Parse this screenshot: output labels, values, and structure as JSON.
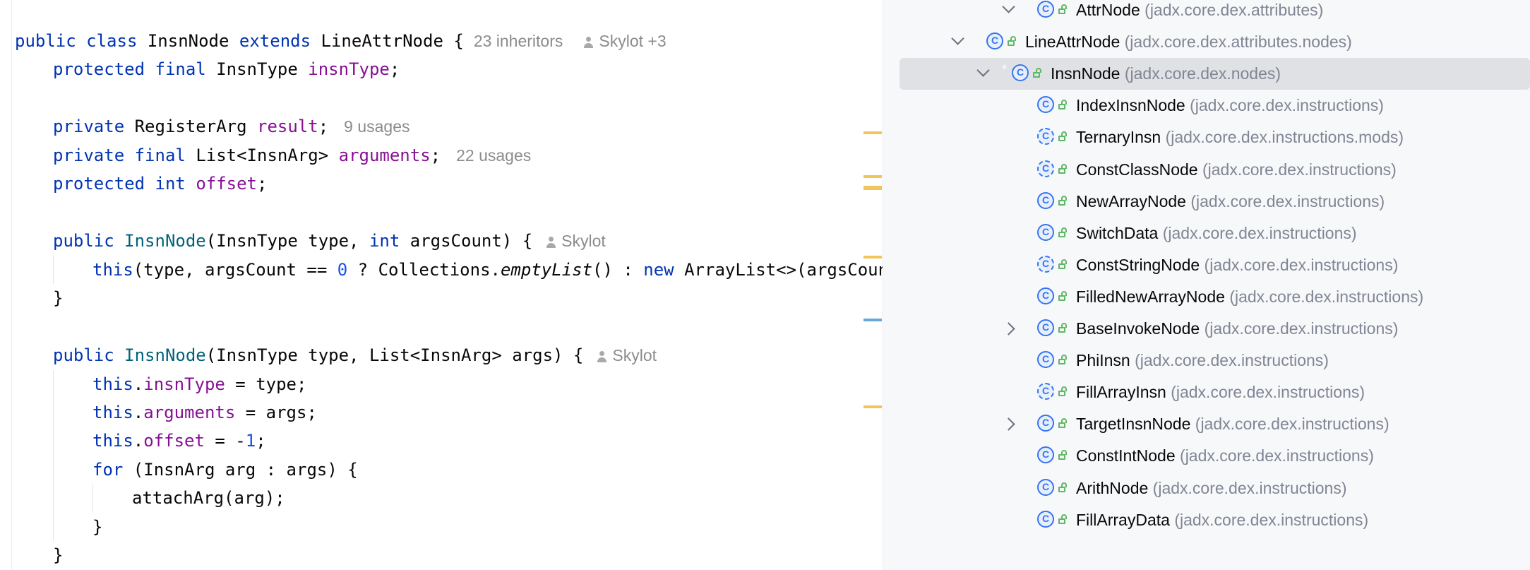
{
  "editor": {
    "class_decl": {
      "kw_public": "public",
      "kw_class": "class",
      "class_name": "InsnNode",
      "kw_extends": "extends",
      "parent_name": "LineAttrNode",
      "brace": "{",
      "inheritors_hint": "23 inheritors",
      "author_hint": "Skylot +3"
    },
    "field_insnType": {
      "kw1": "protected",
      "kw2": "final",
      "type": "InsnType",
      "name": "insnType",
      "end": ";"
    },
    "field_result": {
      "kw1": "private",
      "type": "RegisterArg",
      "name": "result",
      "end": ";",
      "usages": "9 usages"
    },
    "field_arguments": {
      "kw1": "private",
      "kw2": "final",
      "type": "List<InsnArg>",
      "name": "arguments",
      "end": ";",
      "usages": "22 usages"
    },
    "field_offset": {
      "kw1": "protected",
      "kw2": "int",
      "name": "offset",
      "end": ";"
    },
    "ctor1": {
      "kw": "public",
      "name": "InsnNode",
      "params_a": "(InsnType type, ",
      "kw_int": "int",
      "params_b": " argsCount) {",
      "author_hint": "Skylot",
      "body_this": "this",
      "body_a": "(type, argsCount == ",
      "body_zero": "0",
      "body_b": " ? Collections.",
      "body_call": "emptyList",
      "body_c": "() : ",
      "body_new": "new",
      "body_d": " ArrayList<>(argsCount)",
      "close": "}"
    },
    "ctor2": {
      "kw": "public",
      "name": "InsnNode",
      "params": "(InsnType type, List<InsnArg> args) {",
      "author_hint": "Skylot",
      "line1_this": "this",
      "line1_field": "insnType",
      "line1_rest": " = type;",
      "line2_this": "this",
      "line2_field": "arguments",
      "line2_rest": " = args;",
      "line3_this": "this",
      "line3_field": "offset",
      "line3_mid": " = -",
      "line3_num": "1",
      "line3_end": ";",
      "for_kw": "for",
      "for_rest": " (InsnArg arg : args) {",
      "attach": "attachArg(arg);",
      "inner_close": "}",
      "close": "}"
    }
  },
  "hierarchy": {
    "nodes": [
      {
        "name": "AttrNode",
        "pkg": "(jadx.core.dex.attributes)",
        "expander": "expanded"
      },
      {
        "name": "LineAttrNode",
        "pkg": "(jadx.core.dex.attributes.nodes)",
        "expander": "expanded"
      },
      {
        "name": "InsnNode",
        "pkg": "(jadx.core.dex.nodes)",
        "expander": "expanded",
        "selected": true
      },
      {
        "name": "IndexInsnNode",
        "pkg": "(jadx.core.dex.instructions)"
      },
      {
        "name": "TernaryInsn",
        "pkg": "(jadx.core.dex.instructions.mods)"
      },
      {
        "name": "ConstClassNode",
        "pkg": "(jadx.core.dex.instructions)"
      },
      {
        "name": "NewArrayNode",
        "pkg": "(jadx.core.dex.instructions)"
      },
      {
        "name": "SwitchData",
        "pkg": "(jadx.core.dex.instructions)"
      },
      {
        "name": "ConstStringNode",
        "pkg": "(jadx.core.dex.instructions)"
      },
      {
        "name": "FilledNewArrayNode",
        "pkg": "(jadx.core.dex.instructions)"
      },
      {
        "name": "BaseInvokeNode",
        "pkg": "(jadx.core.dex.instructions)",
        "expander": "collapsed"
      },
      {
        "name": "PhiInsn",
        "pkg": "(jadx.core.dex.instructions)"
      },
      {
        "name": "FillArrayInsn",
        "pkg": "(jadx.core.dex.instructions)"
      },
      {
        "name": "TargetInsnNode",
        "pkg": "(jadx.core.dex.instructions)",
        "expander": "collapsed"
      },
      {
        "name": "ConstIntNode",
        "pkg": "(jadx.core.dex.instructions)"
      },
      {
        "name": "ArithNode",
        "pkg": "(jadx.core.dex.instructions)"
      },
      {
        "name": "FillArrayData",
        "pkg": "(jadx.core.dex.instructions)"
      }
    ]
  },
  "colors": {
    "keyword": "#0033b3",
    "field": "#871094",
    "method": "#00627a",
    "number": "#1750eb",
    "hint": "#8c8c8c",
    "package": "#818594",
    "selection": "#dfe1e5",
    "class_icon": "#3574f0",
    "public_icon": "#5fb865",
    "marker_warning": "#f2c55c",
    "marker_info": "#6aa8d8"
  },
  "icons": {
    "class": "class-icon",
    "public": "public-lock-icon",
    "expander": "chevron-icon",
    "author": "user-icon"
  }
}
